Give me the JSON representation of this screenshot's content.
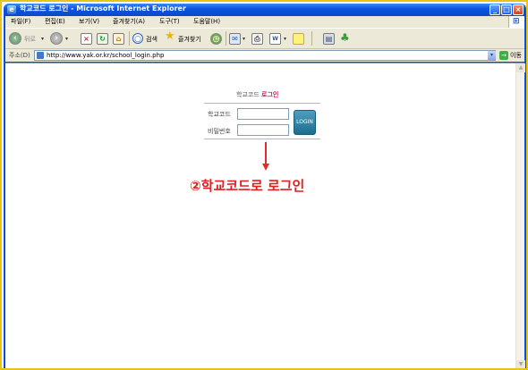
{
  "window": {
    "title": "학교코드 로그인 - Microsoft Internet Explorer",
    "minimize": "_",
    "maximize": "□",
    "close": "×"
  },
  "menu": [
    "파일(F)",
    "편집(E)",
    "보기(V)",
    "즐겨찾기(A)",
    "도구(T)",
    "도움말(H)"
  ],
  "toolbar": {
    "back_label": "뒤로",
    "search_label": "검색",
    "favorites_label": "즐겨찾기"
  },
  "address": {
    "label": "주소(D)",
    "url": "http://www.yak.or.kr/school_login.php",
    "go_label": "이동"
  },
  "login": {
    "title_prefix": "학교코드",
    "title_highlight": "로그인",
    "code_label": "학교코드",
    "password_label": "비밀번호",
    "code_value": "",
    "password_value": "",
    "button_label": "LOGIN"
  },
  "annotation": {
    "text": "②학교코드로 로그인",
    "color": "#e0201c"
  },
  "icons": [
    "app-icon",
    "back-icon",
    "forward-icon",
    "stop-icon",
    "refresh-icon",
    "home-icon",
    "search-icon",
    "favorites-icon",
    "history-icon",
    "mail-icon",
    "print-icon",
    "edit-icon",
    "discuss-icon",
    "messenger-icon",
    "go-icon",
    "windows-logo-icon"
  ]
}
